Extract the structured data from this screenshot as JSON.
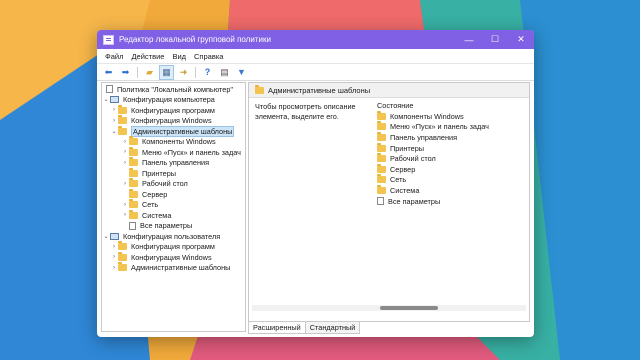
{
  "window": {
    "title": "Редактор локальной групповой политики",
    "controls": {
      "minimize": "—",
      "maximize": "☐",
      "close": "✕"
    }
  },
  "menubar": [
    "Файл",
    "Действие",
    "Вид",
    "Справка"
  ],
  "toolbar_icons": [
    "back-icon",
    "forward-icon",
    "folder-up-icon",
    "show-hide-tree-icon",
    "export-icon",
    "help-icon",
    "properties-icon",
    "filter-icon"
  ],
  "tree": [
    {
      "label": "Политика \"Локальный компьютер\"",
      "icon": "policy-icon"
    },
    {
      "label": "Конфигурация компьютера",
      "icon": "computer-icon"
    },
    {
      "label": "Конфигурация программ",
      "icon": "folder-icon"
    },
    {
      "label": "Конфигурация Windows",
      "icon": "folder-icon"
    },
    {
      "label": "Административные шаблоны",
      "icon": "folder-icon",
      "selected": true
    },
    {
      "label": "Компоненты Windows",
      "icon": "folder-icon"
    },
    {
      "label": "Меню «Пуск» и панель задач",
      "icon": "folder-icon"
    },
    {
      "label": "Панель управления",
      "icon": "folder-icon"
    },
    {
      "label": "Принтеры",
      "icon": "folder-icon"
    },
    {
      "label": "Рабочий стол",
      "icon": "folder-icon"
    },
    {
      "label": "Сервер",
      "icon": "folder-icon"
    },
    {
      "label": "Сеть",
      "icon": "folder-icon"
    },
    {
      "label": "Система",
      "icon": "folder-icon"
    },
    {
      "label": "Все параметры",
      "icon": "settings-doc-icon"
    },
    {
      "label": "Конфигурация пользователя",
      "icon": "user-config-icon"
    },
    {
      "label": "Конфигурация программ",
      "icon": "folder-icon"
    },
    {
      "label": "Конфигурация Windows",
      "icon": "folder-icon"
    },
    {
      "label": "Административные шаблоны",
      "icon": "folder-icon"
    }
  ],
  "right": {
    "header": "Административные шаблоны",
    "description": "Чтобы просмотреть описание элемента, выделите его.",
    "column_header": "Состояние",
    "items": [
      "Компоненты Windows",
      "Меню «Пуск» и панель задач",
      "Панель управления",
      "Принтеры",
      "Рабочий стол",
      "Сервер",
      "Сеть",
      "Система",
      "Все параметры"
    ]
  },
  "tabs": [
    "Расширенный",
    "Стандартный"
  ],
  "colors": {
    "titlebar": "#8060e4",
    "selection": "#cce4f7"
  }
}
